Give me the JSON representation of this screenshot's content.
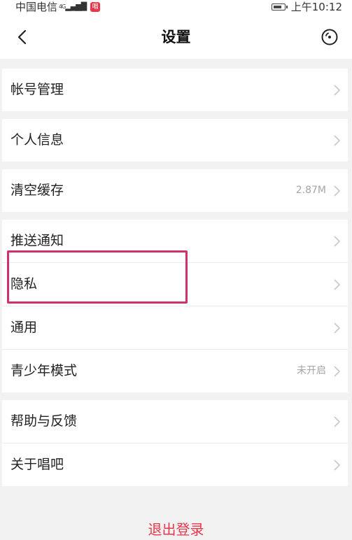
{
  "status_bar": {
    "carrier": "中国电信",
    "network": "4G",
    "time": "上午10:12"
  },
  "nav": {
    "title": "设置",
    "back_icon": "chevron-left-icon",
    "action_icon": "music-disc-icon"
  },
  "groups": [
    {
      "items": [
        {
          "label": "帐号管理",
          "value": ""
        }
      ]
    },
    {
      "items": [
        {
          "label": "个人信息",
          "value": ""
        }
      ]
    },
    {
      "items": [
        {
          "label": "清空缓存",
          "value": "2.87M"
        }
      ]
    },
    {
      "items": [
        {
          "label": "推送通知",
          "value": ""
        },
        {
          "label": "隐私",
          "value": ""
        },
        {
          "label": "通用",
          "value": ""
        },
        {
          "label": "青少年模式",
          "value": "未开启"
        }
      ]
    },
    {
      "items": [
        {
          "label": "帮助与反馈",
          "value": ""
        },
        {
          "label": "关于唱吧",
          "value": ""
        }
      ]
    }
  ],
  "logout_label": "退出登录",
  "colors": {
    "accent": "#e8374a",
    "highlight": "#d0306f",
    "background": "#f2f2f2"
  }
}
